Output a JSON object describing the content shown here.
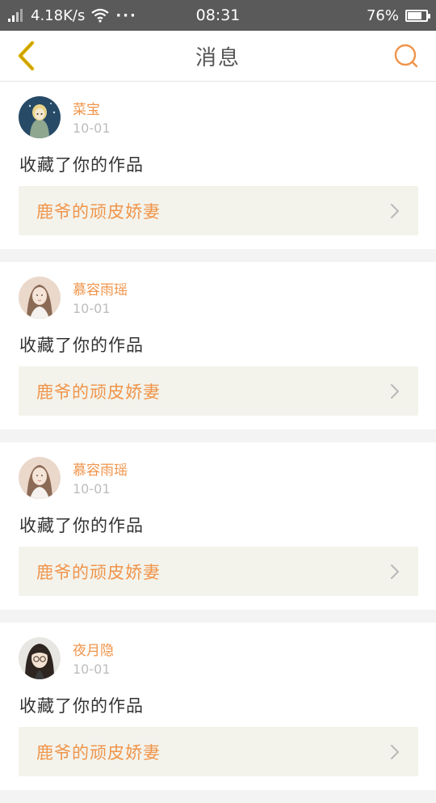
{
  "status_bar": {
    "speed": "4.18K/s",
    "more": "···",
    "time": "08:31",
    "battery": "76%",
    "battery_level": 0.76
  },
  "header": {
    "title": "消息",
    "back_icon": "chevron-left-icon",
    "search_icon": "search-icon"
  },
  "colors": {
    "accent": "#f0944a",
    "back": "#e0b400",
    "card_link_bg": "#f3f3ec"
  },
  "messages": [
    {
      "username": "菜宝",
      "date": "10-01",
      "action": "收藏了你的作品",
      "work_title": "鹿爷的顽皮娇妻"
    },
    {
      "username": "慕容雨瑶",
      "date": "10-01",
      "action": "收藏了你的作品",
      "work_title": "鹿爷的顽皮娇妻"
    },
    {
      "username": "慕容雨瑶",
      "date": "10-01",
      "action": "收藏了你的作品",
      "work_title": "鹿爷的顽皮娇妻"
    },
    {
      "username": "夜月隐",
      "date": "10-01",
      "action": "收藏了你的作品",
      "work_title": "鹿爷的顽皮娇妻"
    }
  ]
}
